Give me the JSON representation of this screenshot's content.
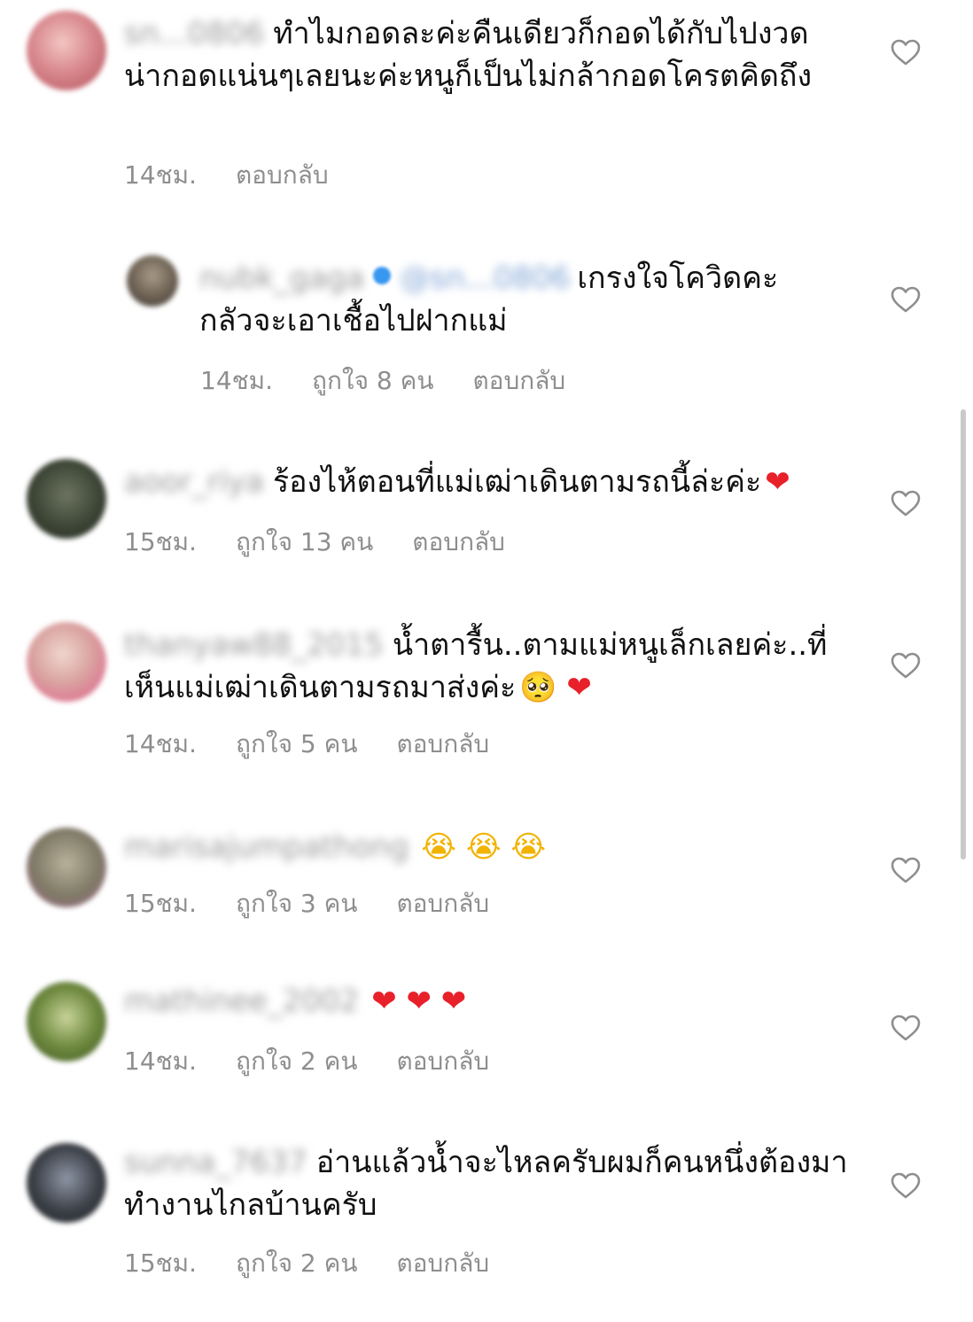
{
  "comments": [
    {
      "username": "sn...0806",
      "text": "ทำไมกอดละค่ะคืนเดียวก็กอดได้กับไปงวดน่ากอดแน่นๆเลยนะค่ะหนูก็เป็นไม่กล้ากอดโครตคิดถึง",
      "emoji": "",
      "time": "14ชม.",
      "likes": "",
      "reply": "ตอบกลับ",
      "avatar_color": "#c7686d"
    },
    {
      "username": "nubk_gaga",
      "mention": "@sn...0806",
      "text": "เกรงใจโควิดคะ กลัวจะเอาเชื้อไปฝากแม่",
      "emoji": "",
      "time": "14ชม.",
      "likes": "ถูกใจ 8 คน",
      "reply": "ตอบกลับ",
      "avatar_color": "#6a6055"
    },
    {
      "username": "aoor_riya",
      "text": "ร้องไห้ตอนที่แม่เฒ่าเดินตามรถนี้ล่ะค่ะ",
      "emoji": "❤",
      "time": "15ชม.",
      "likes": "ถูกใจ 13 คน",
      "reply": "ตอบกลับ",
      "avatar_color": "#3c4436"
    },
    {
      "username": "thanyaw88_2015",
      "text": "น้ำตารื้น..ตามแม่หนูเล็กเลยค่ะ..ที่เห็นแม่เฒ่าเดินตามรถมาส่งค่ะ",
      "emoji": "🥺 ❤",
      "time": "14ชม.",
      "likes": "ถูกใจ 5 คน",
      "reply": "ตอบกลับ",
      "avatar_color": "#c98a8a"
    },
    {
      "username": "marisajumpathong",
      "text": "",
      "emoji": "😭 😭 😭",
      "time": "15ชม.",
      "likes": "ถูกใจ 3 คน",
      "reply": "ตอบกลับ",
      "avatar_color": "#8a8670"
    },
    {
      "username": "mathinee_2002",
      "text": "",
      "emoji": "❤ ❤ ❤",
      "time": "14ชม.",
      "likes": "ถูกใจ 2 คน",
      "reply": "ตอบกลับ",
      "avatar_color": "#5d7a3a"
    },
    {
      "username": "sunna_7637",
      "text": "อ่านแล้วน้ำจะไหลครับผมก็คนหนึ่งต้องมาทำงานไกลบ้านครับ",
      "emoji": "",
      "time": "15ชม.",
      "likes": "ถูกใจ 2 คน",
      "reply": "ตอบกลับ",
      "avatar_color": "#3b3f46"
    }
  ],
  "icons": {
    "like": "heart-outline-icon"
  },
  "colors": {
    "meta": "#8e8e8e",
    "heart": "#e8202a",
    "verified": "#3897f0"
  }
}
